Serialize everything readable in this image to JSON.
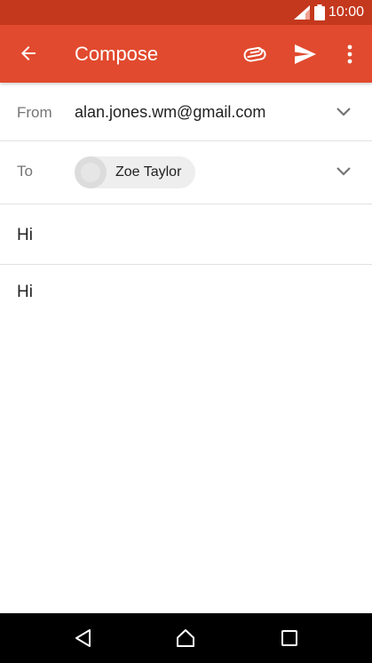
{
  "status_bar": {
    "time": "10:00",
    "signal_icon": "signal-icon",
    "battery_icon": "battery-icon"
  },
  "app_bar": {
    "title": "Compose",
    "back_icon": "arrow-back-icon",
    "attach_icon": "paperclip-icon",
    "send_icon": "send-icon",
    "more_icon": "more-vert-icon"
  },
  "compose": {
    "from_label": "From",
    "from_value": "alan.jones.wm@gmail.com",
    "to_label": "To",
    "to_recipient": "Zoe Taylor",
    "subject": "Hi",
    "body": "Hi"
  },
  "nav_bar": {
    "back_icon": "nav-back-icon",
    "home_icon": "nav-home-icon",
    "recents_icon": "nav-recents-icon"
  },
  "colors": {
    "status_bar": "#c4381d",
    "app_bar": "#e14a2e",
    "nav_bar": "#000000"
  }
}
